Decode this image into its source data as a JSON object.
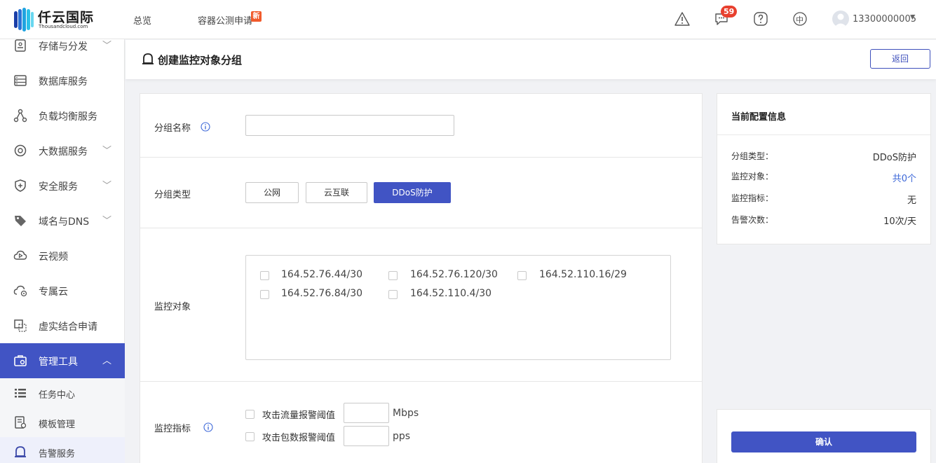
{
  "brand": {
    "name": "仟云国际",
    "sub": "Thousandcloud.com"
  },
  "topnav": {
    "overview": "总览",
    "container_beta": "容器公测申请",
    "new_badge": "新",
    "message_count": "59",
    "lang": "中",
    "user": "13300000005"
  },
  "sidebar": {
    "items": [
      {
        "label": "存储与分发",
        "icon": "storage-icon",
        "caret": true
      },
      {
        "label": "数据库服务",
        "icon": "database-icon",
        "caret": false
      },
      {
        "label": "负载均衡服务",
        "icon": "load-balancer-icon",
        "caret": false
      },
      {
        "label": "大数据服务",
        "icon": "bigdata-icon",
        "caret": true
      },
      {
        "label": "安全服务",
        "icon": "shield-icon",
        "caret": true
      },
      {
        "label": "域名与DNS",
        "icon": "tag-icon",
        "caret": true
      },
      {
        "label": "云视频",
        "icon": "video-cloud-icon",
        "caret": false
      },
      {
        "label": "专属云",
        "icon": "private-cloud-icon",
        "caret": false
      },
      {
        "label": "虚实结合申请",
        "icon": "hybrid-icon",
        "caret": false
      },
      {
        "label": "管理工具",
        "icon": "toolbox-icon",
        "caret": true
      }
    ],
    "sub_items": [
      {
        "label": "任务中心",
        "icon": "list-icon"
      },
      {
        "label": "模板管理",
        "icon": "template-icon"
      },
      {
        "label": "告警服务",
        "icon": "alarm-icon"
      }
    ]
  },
  "page": {
    "title": "创建监控对象分组",
    "back": "返回"
  },
  "form": {
    "name_label": "分组名称",
    "name_value": "",
    "type_label": "分组类型",
    "types": [
      "公网",
      "云互联",
      "DDoS防护"
    ],
    "selected_type": "DDoS防护",
    "target_label": "监控对象",
    "targets": [
      "164.52.76.44/30",
      "164.52.76.120/30",
      "164.52.110.16/29",
      "164.52.76.84/30",
      "164.52.110.4/30"
    ],
    "metric_label": "监控指标",
    "metrics": [
      {
        "label": "攻击流量报警阈值",
        "unit": "Mbps",
        "value": ""
      },
      {
        "label": "攻击包数报警阈值",
        "unit": "pps",
        "value": ""
      }
    ]
  },
  "summary": {
    "title": "当前配置信息",
    "rows": [
      {
        "key": "分组类型：",
        "value": "DDoS防护"
      },
      {
        "key": "监控对象：",
        "value": "共0个"
      },
      {
        "key": "监控指标：",
        "value": "无"
      },
      {
        "key": "告警次数：",
        "value": "10次/天"
      }
    ],
    "confirm": "确认"
  },
  "colors": {
    "primary": "#4154c4",
    "link": "#3d68d8",
    "badge": "#e8402e",
    "new_badge": "#f15a2b"
  }
}
